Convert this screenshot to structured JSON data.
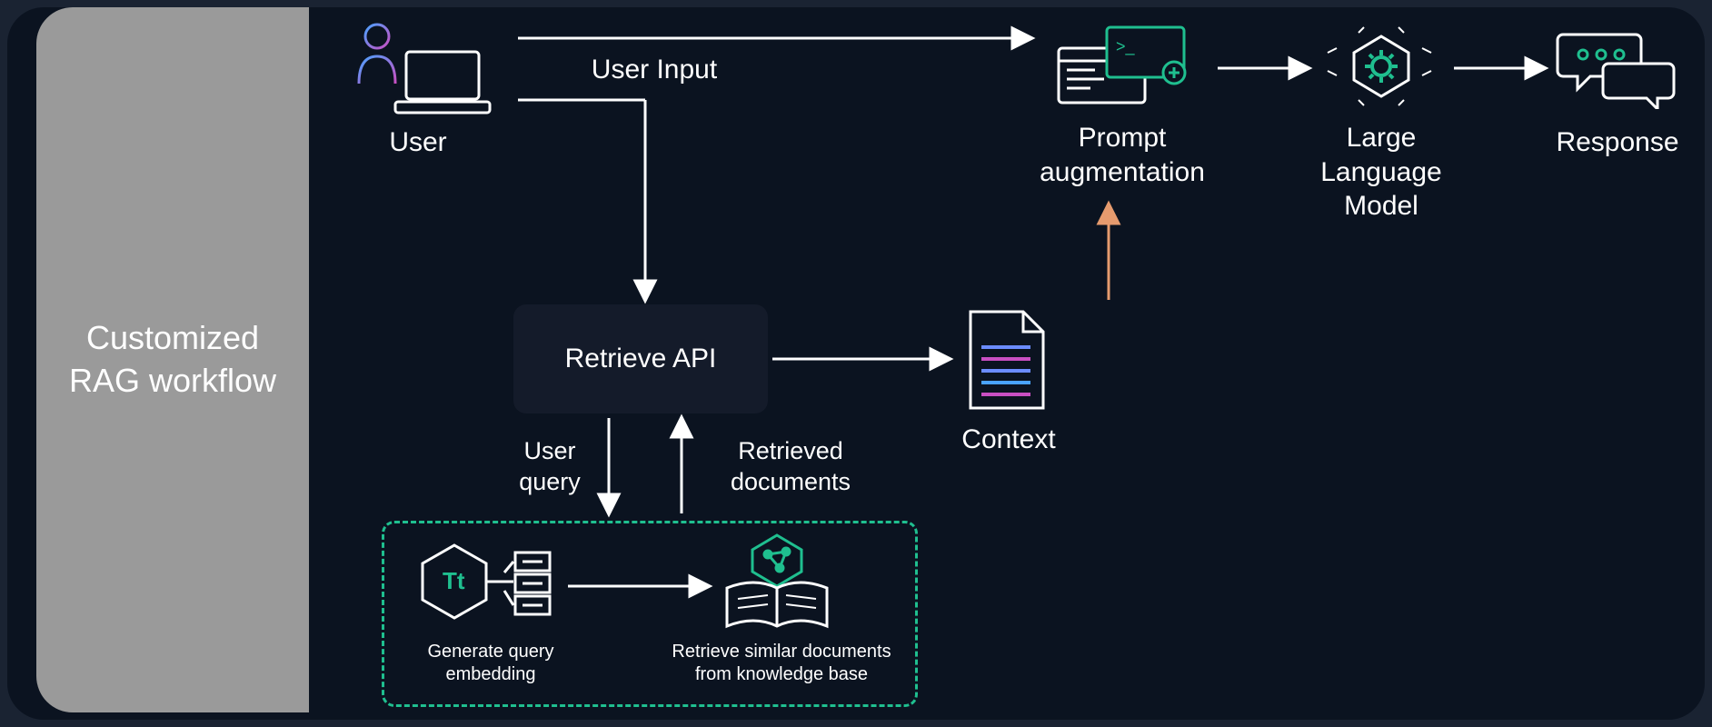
{
  "sidebar": {
    "title": "Customized RAG workflow"
  },
  "nodes": {
    "user": "User",
    "user_input": "User Input",
    "retrieve_api": "Retrieve API",
    "prompt_aug": "Prompt augmentation",
    "llm": "Large Language Model",
    "response": "Response",
    "context": "Context",
    "user_query": "User query",
    "retrieved_docs": "Retrieved documents",
    "gen_embed": "Generate query embedding",
    "retrieve_kb": "Retrieve similar documents from knowledge base"
  }
}
